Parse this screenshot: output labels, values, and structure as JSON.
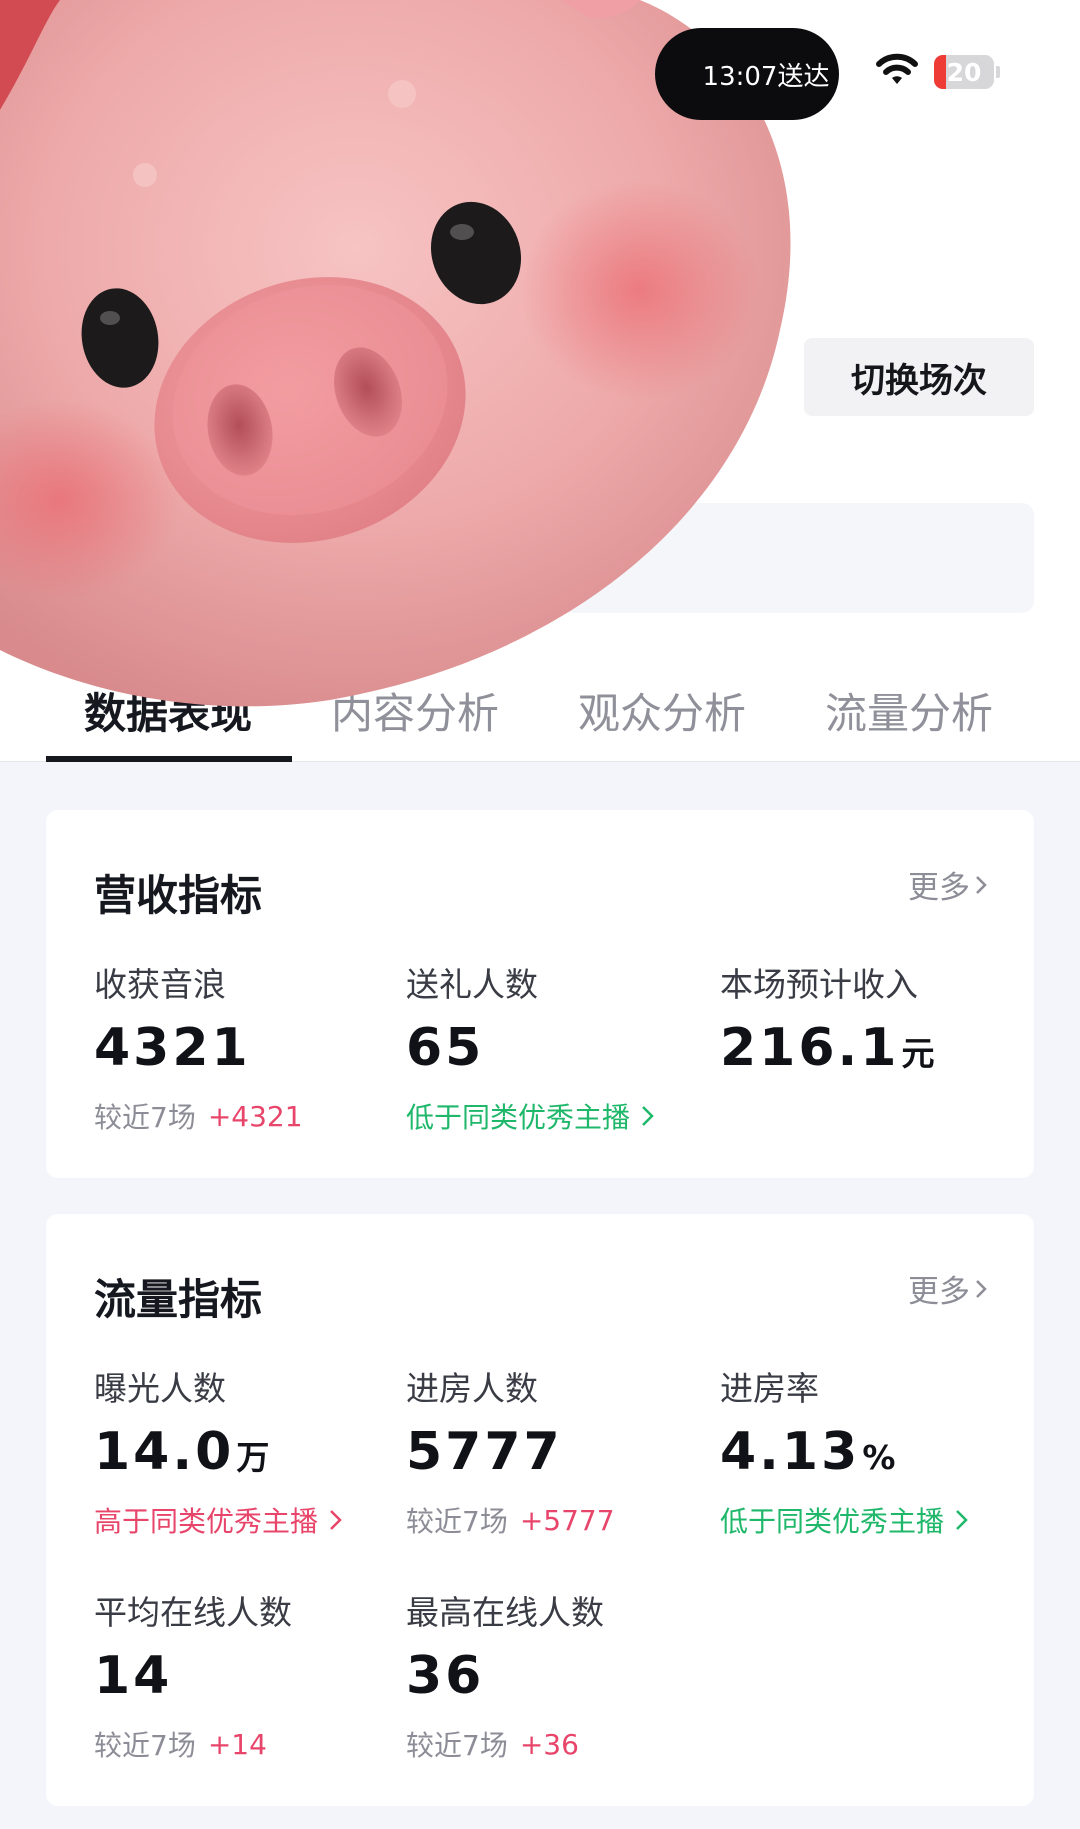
{
  "status_bar": {
    "time_text": "13:07送达",
    "battery_level": "20",
    "battery_fraction": 0.2,
    "wifi_icon": "wifi-icon",
    "battery_color": "#ef3b36"
  },
  "header": {
    "switch_button": "切换场次"
  },
  "tabs": [
    {
      "label": "数据表现",
      "active": true
    },
    {
      "label": "内容分析",
      "active": false
    },
    {
      "label": "观众分析",
      "active": false
    },
    {
      "label": "流量分析",
      "active": false
    }
  ],
  "revenue_card": {
    "title": "营收指标",
    "more": "更多",
    "metrics": [
      {
        "label": "收获音浪",
        "value": "4321",
        "unit": "",
        "sub_prefix": "较近7场",
        "sub_delta": "+4321"
      },
      {
        "label": "送礼人数",
        "value": "65",
        "unit": "",
        "sub_text": "低于同类优秀主播"
      },
      {
        "label": "本场预计收入",
        "value": "216.1",
        "unit": "元"
      }
    ]
  },
  "traffic_card": {
    "title": "流量指标",
    "more": "更多",
    "metrics": [
      {
        "label": "曝光人数",
        "value": "14.0",
        "unit": "万",
        "sub_text": "高于同类优秀主播"
      },
      {
        "label": "进房人数",
        "value": "5777",
        "unit": "",
        "sub_prefix": "较近7场",
        "sub_delta": "+5777"
      },
      {
        "label": "进房率",
        "value": "4.13",
        "unit": "%",
        "sub_text": "低于同类优秀主播"
      },
      {
        "label": "平均在线人数",
        "value": "14",
        "unit": "",
        "sub_prefix": "较近7场",
        "sub_delta": "+14"
      },
      {
        "label": "最高在线人数",
        "value": "36",
        "unit": "",
        "sub_prefix": "较近7场",
        "sub_delta": "+36"
      }
    ]
  },
  "colors": {
    "positive_red": "#e8456b",
    "green": "#1fb86b",
    "muted": "#8c8d96"
  }
}
